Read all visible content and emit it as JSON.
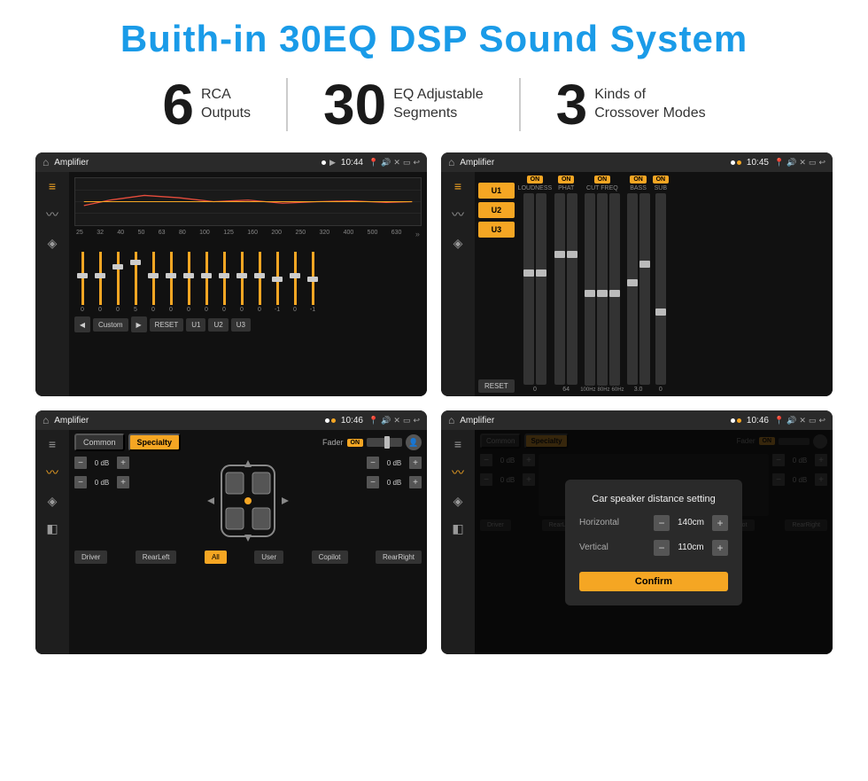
{
  "title": "Buith-in 30EQ DSP Sound System",
  "stats": [
    {
      "number": "6",
      "label_line1": "RCA",
      "label_line2": "Outputs"
    },
    {
      "number": "30",
      "label_line1": "EQ Adjustable",
      "label_line2": "Segments"
    },
    {
      "number": "3",
      "label_line1": "Kinds of",
      "label_line2": "Crossover Modes"
    }
  ],
  "screens": [
    {
      "id": "eq-screen",
      "topbar": {
        "title": "Amplifier",
        "time": "10:44",
        "dots": "play"
      },
      "type": "eq"
    },
    {
      "id": "crossover-screen",
      "topbar": {
        "title": "Amplifier",
        "time": "10:45",
        "dots": "record"
      },
      "type": "crossover"
    },
    {
      "id": "fader-screen",
      "topbar": {
        "title": "Amplifier",
        "time": "10:46",
        "dots": "record"
      },
      "type": "fader"
    },
    {
      "id": "dialog-screen",
      "topbar": {
        "title": "Amplifier",
        "time": "10:46",
        "dots": "record"
      },
      "type": "fader-dialog",
      "dialog": {
        "title": "Car speaker distance setting",
        "horizontal_label": "Horizontal",
        "horizontal_value": "140cm",
        "vertical_label": "Vertical",
        "vertical_value": "110cm",
        "confirm_label": "Confirm"
      }
    }
  ],
  "eq": {
    "freqs": [
      "25",
      "32",
      "40",
      "50",
      "63",
      "80",
      "100",
      "125",
      "160",
      "200",
      "250",
      "320",
      "400",
      "500",
      "630"
    ],
    "values": [
      "0",
      "0",
      "0",
      "5",
      "0",
      "0",
      "0",
      "0",
      "0",
      "0",
      "0",
      "-1",
      "0",
      "-1"
    ],
    "preset": "Custom",
    "buttons": [
      "RESET",
      "U1",
      "U2",
      "U3"
    ]
  },
  "crossover": {
    "u_buttons": [
      "U1",
      "U2",
      "U3"
    ],
    "columns": [
      {
        "label": "LOUDNESS",
        "on": true
      },
      {
        "label": "PHAT",
        "on": true
      },
      {
        "label": "CUT FREQ",
        "on": true
      },
      {
        "label": "BASS",
        "on": true
      },
      {
        "label": "SUB",
        "on": true
      }
    ],
    "reset_label": "RESET"
  },
  "fader": {
    "tabs": [
      "Common",
      "Specialty"
    ],
    "fader_label": "Fader",
    "on_label": "ON",
    "db_controls": [
      "0 dB",
      "0 dB",
      "0 dB",
      "0 dB"
    ],
    "bottom_buttons": [
      "Driver",
      "RearLeft",
      "All",
      "User",
      "Copilot",
      "RearRight"
    ]
  },
  "dialog": {
    "title": "Car speaker distance setting",
    "horizontal_label": "Horizontal",
    "horizontal_value": "140cm",
    "vertical_label": "Vertical",
    "vertical_value": "110cm",
    "confirm_label": "Confirm"
  }
}
